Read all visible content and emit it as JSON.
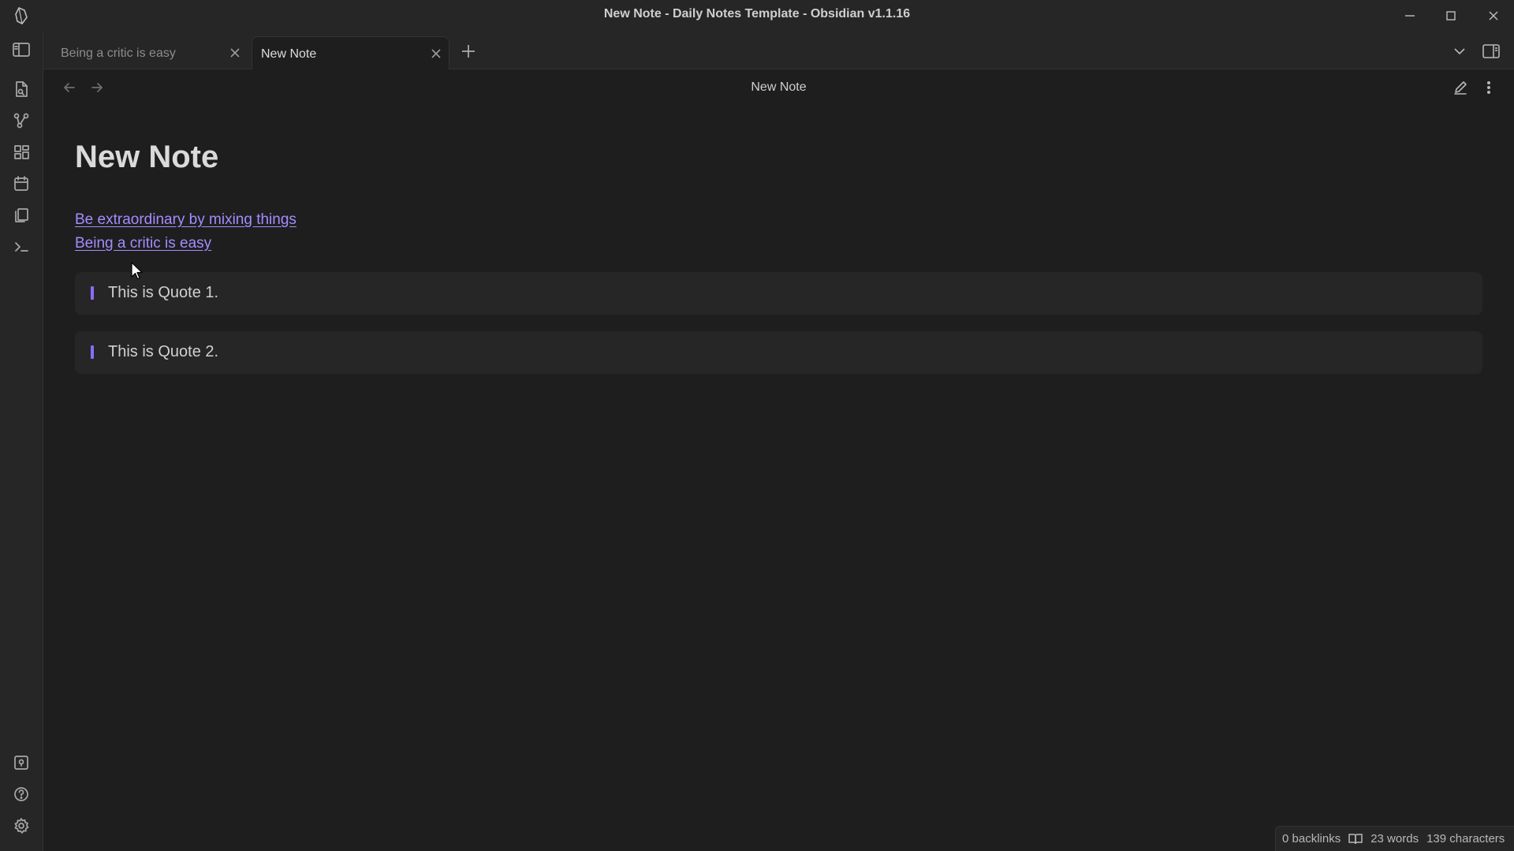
{
  "window": {
    "title": "New Note - Daily Notes Template - Obsidian v1.1.16"
  },
  "tabs": [
    {
      "label": "Being a critic is easy",
      "active": false
    },
    {
      "label": "New Note",
      "active": true
    }
  ],
  "header": {
    "view_title": "New Note"
  },
  "note": {
    "title": "New Note",
    "links": [
      "Be extraordinary by mixing things",
      "Being a critic is easy"
    ],
    "quotes": [
      "This is Quote 1.",
      "This is Quote 2."
    ]
  },
  "status": {
    "backlinks": "0 backlinks",
    "words": "23 words",
    "characters": "139 characters"
  },
  "colors": {
    "background": "#1e1e1e",
    "chrome": "#262626",
    "accent": "#8b6cff",
    "link": "#a48cff"
  },
  "icons": {
    "ribbon_top": [
      "switcher-icon",
      "graph-icon",
      "canvas-icon",
      "calendar-icon",
      "templates-icon",
      "command-palette-icon"
    ],
    "ribbon_bottom": [
      "vault-icon",
      "help-icon",
      "settings-icon"
    ]
  }
}
